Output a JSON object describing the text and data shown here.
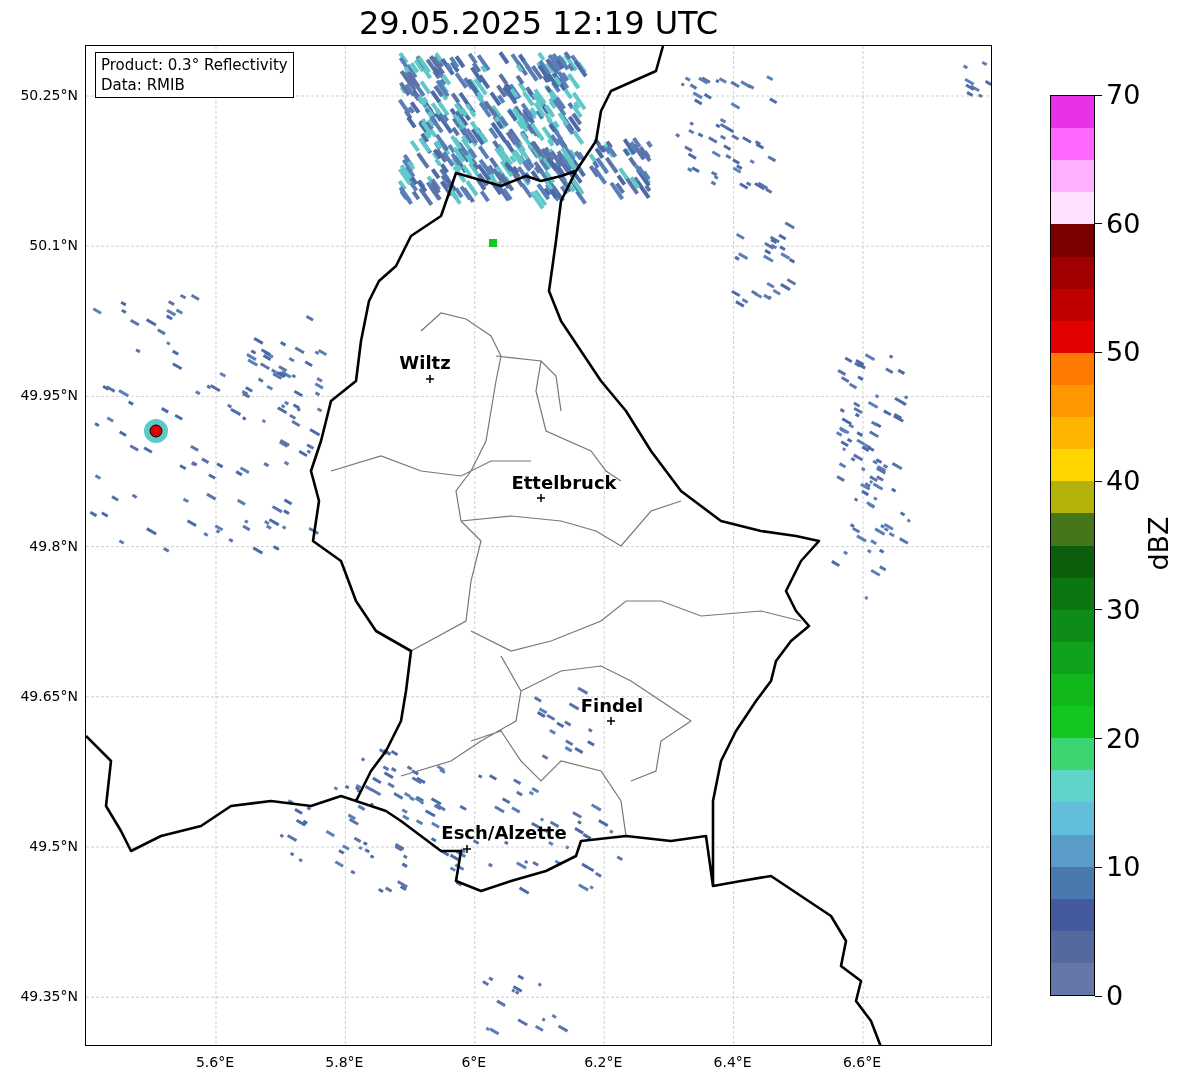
{
  "title": "29.05.2025 12:19 UTC",
  "map": {
    "info_box": [
      "Product: 0.3° Reflectivity",
      "Data: RMIB"
    ],
    "y_ticks": [
      "50.25°N",
      "50.1°N",
      "49.95°N",
      "49.8°N",
      "49.65°N",
      "49.5°N",
      "49.35°N"
    ],
    "x_ticks": [
      "5.6°E",
      "5.8°E",
      "6°E",
      "6.2°E",
      "6.4°E",
      "6.6°E"
    ],
    "places": [
      {
        "name": "Wiltz"
      },
      {
        "name": "Ettelbruck"
      },
      {
        "name": "Findel"
      },
      {
        "name": "Esch/Alzette"
      }
    ]
  },
  "colorbar": {
    "label": "dBZ",
    "ticks": [
      "70",
      "60",
      "50",
      "40",
      "30",
      "20",
      "10",
      "0"
    ],
    "segments": [
      {
        "color": "#e832e8"
      },
      {
        "color": "#ff68ff"
      },
      {
        "color": "#ffb0ff"
      },
      {
        "color": "#ffe0ff"
      },
      {
        "color": "#7a0000"
      },
      {
        "color": "#a00000"
      },
      {
        "color": "#c00000"
      },
      {
        "color": "#e20000"
      },
      {
        "color": "#ff7a00"
      },
      {
        "color": "#ff9800"
      },
      {
        "color": "#ffb400"
      },
      {
        "color": "#ffd600"
      },
      {
        "color": "#b2b20a"
      },
      {
        "color": "#46761a"
      },
      {
        "color": "#0a5e0c"
      },
      {
        "color": "#0b7612"
      },
      {
        "color": "#0e8c18"
      },
      {
        "color": "#0fa21a"
      },
      {
        "color": "#10b81c"
      },
      {
        "color": "#12c820"
      },
      {
        "color": "#3cd670"
      },
      {
        "color": "#5fd4c8"
      },
      {
        "color": "#62bedb"
      },
      {
        "color": "#5a9cc8"
      },
      {
        "color": "#4a79b0"
      },
      {
        "color": "#44599e"
      },
      {
        "color": "#55699f"
      },
      {
        "color": "#6477a8"
      }
    ]
  }
}
